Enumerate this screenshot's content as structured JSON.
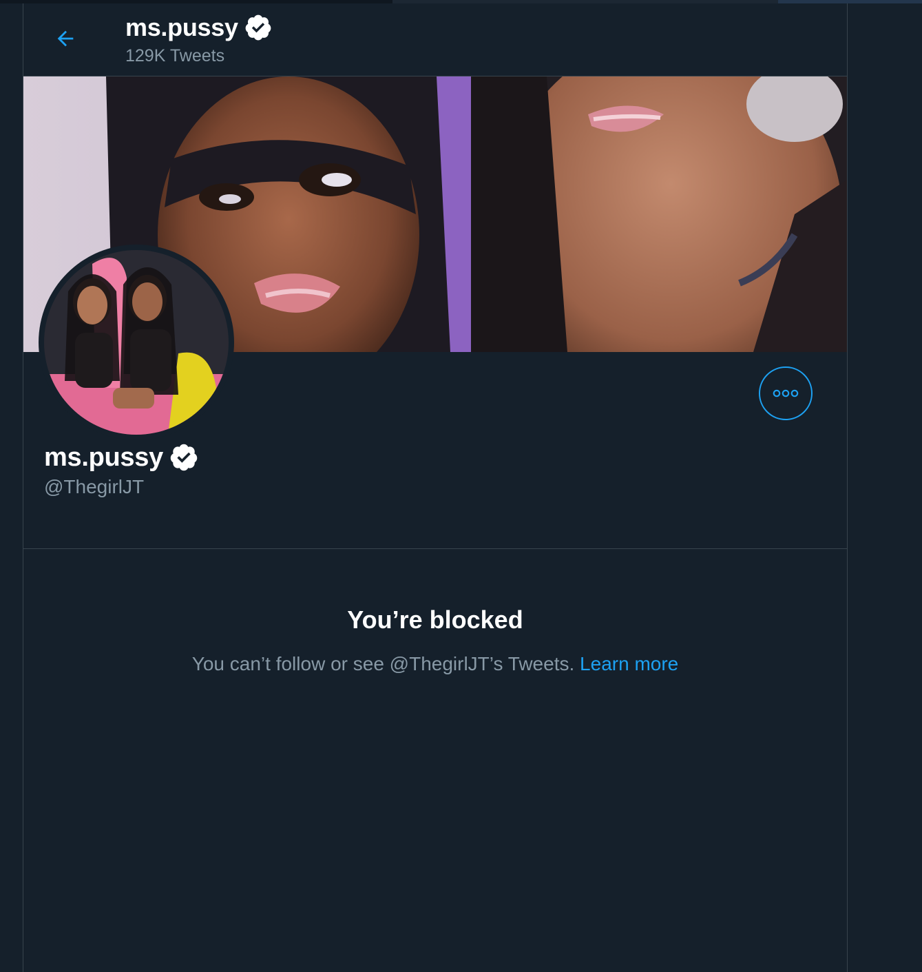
{
  "colors": {
    "background": "#15202b",
    "border": "#38444d",
    "accent": "#1da1f2",
    "secondary_text": "#8899a6",
    "primary_text": "#ffffff"
  },
  "header": {
    "back_icon": "arrow-left-icon",
    "name": "ms.pussy",
    "verified_icon": "verified-badge-icon",
    "tweet_count": "129K Tweets"
  },
  "profile": {
    "name": "ms.pussy",
    "verified_icon": "verified-badge-icon",
    "handle": "@ThegirlJT",
    "more_icon": "more-horizontal-icon"
  },
  "blocked": {
    "title": "You’re blocked",
    "message": "You can’t follow or see @ThegirlJT’s Tweets.",
    "link": "Learn more"
  }
}
